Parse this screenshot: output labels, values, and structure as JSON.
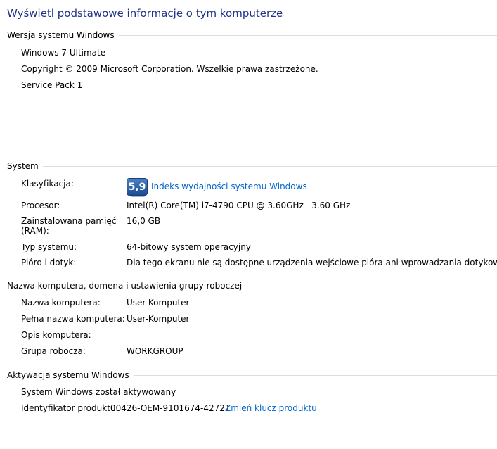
{
  "header": {
    "title": "Wyświetl podstawowe informacje o tym komputerze"
  },
  "edition": {
    "heading": "Wersja systemu Windows",
    "name": "Windows 7 Ultimate",
    "copyright": "Copyright © 2009 Microsoft Corporation. Wszelkie prawa zastrzeżone.",
    "service_pack": "Service Pack 1"
  },
  "system": {
    "heading": "System",
    "rating_label": "Klasyfikacja:",
    "rating_score": "5,9",
    "rating_link": "Indeks wydajności systemu Windows",
    "processor_label": "Procesor:",
    "processor_value": "Intel(R) Core(TM) i7-4790 CPU @ 3.60GHz   3.60 GHz",
    "ram_label_line1": "Zainstalowana pamięć",
    "ram_label_line2": "(RAM):",
    "ram_value": "16,0 GB",
    "type_label": "Typ systemu:",
    "type_value": "64-bitowy system operacyjny",
    "pen_label": "Pióro i dotyk:",
    "pen_value": "Dla tego ekranu nie są dostępne urządzenia wejściowe pióra ani wprowadzania dotykowego"
  },
  "computer": {
    "heading": "Nazwa komputera, domena i ustawienia grupy roboczej",
    "name_label": "Nazwa komputera:",
    "name_value": "User-Komputer",
    "fullname_label": "Pełna nazwa komputera:",
    "fullname_value": "User-Komputer",
    "description_label": "Opis komputera:",
    "description_value": "",
    "workgroup_label": "Grupa robocza:",
    "workgroup_value": "WORKGROUP"
  },
  "activation": {
    "heading": "Aktywacja systemu Windows",
    "status": "System Windows został aktywowany",
    "product_id_label": "Identyfikator produktu:",
    "product_id_value": "00426-OEM-9101674-42721",
    "change_key_link": "Zmień klucz produktu"
  },
  "colors": {
    "title": "#1e3287",
    "link": "#0066cc",
    "rule": "#d5dfe5",
    "badge": "#2b5ca8"
  }
}
